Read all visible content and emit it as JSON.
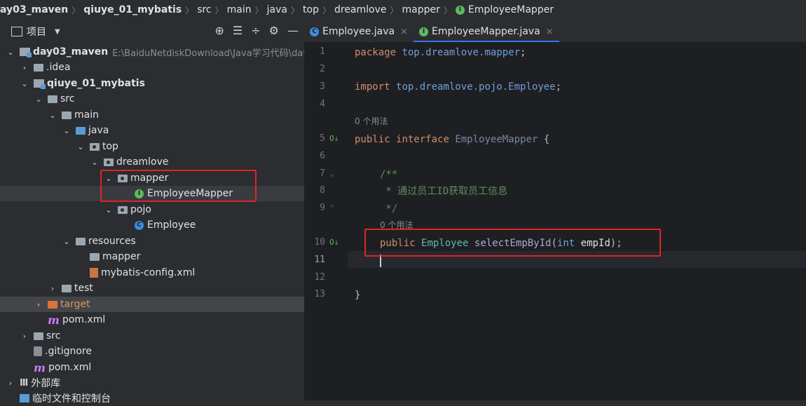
{
  "breadcrumb": [
    "ay03_maven",
    "qiuye_01_mybatis",
    "src",
    "main",
    "java",
    "top",
    "dreamlove",
    "mapper",
    "EmployeeMapper"
  ],
  "panel": {
    "title": "项目",
    "tools": [
      "⊕",
      "☰",
      "÷",
      "⚙",
      "—"
    ]
  },
  "tree": {
    "root_name": "day03_maven",
    "root_path": "E:\\BaiduNetdiskDownload\\Java学习代码\\day",
    "idea": ".idea",
    "module": "qiuye_01_mybatis",
    "src": "src",
    "main": "main",
    "java": "java",
    "top": "top",
    "dreamlove": "dreamlove",
    "mapper": "mapper",
    "employee_mapper": "EmployeeMapper",
    "pojo": "pojo",
    "employee": "Employee",
    "resources": "resources",
    "res_mapper": "mapper",
    "mybatis_config": "mybatis-config.xml",
    "test": "test",
    "target": "target",
    "pom_module": "pom.xml",
    "src_root": "src",
    "gitignore": ".gitignore",
    "pom_root": "pom.xml",
    "ext_libs": "外部库",
    "scratches": "临时文件和控制台"
  },
  "tabs": [
    {
      "label": "Employee.java",
      "close": "×"
    },
    {
      "label": "EmployeeMapper.java",
      "close": "×"
    }
  ],
  "editor": {
    "line_numbers": [
      "1",
      "2",
      "3",
      "4",
      "5",
      "6",
      "7",
      "8",
      "9",
      "10",
      "11",
      "12",
      "13"
    ],
    "current_line": "11",
    "usage_hint_1": "0 个用法",
    "usage_hint_2": "0 个用法",
    "l1_kw": "package",
    "l1_pkg": "top.dreamlove.mapper",
    "l1_end": ";",
    "l3_kw": "import",
    "l3_pkg": "top.dreamlove.pojo.",
    "l3_cls": "Employee",
    "l3_end": ";",
    "l5_kw1": "public",
    "l5_kw2": "interface",
    "l5_name": "EmployeeMapper",
    "l5_brace": "{",
    "l7": "/**",
    "l8": " * 通过员工ID获取员工信息",
    "l9": " */",
    "l10_kw": "public",
    "l10_type": "Employee",
    "l10_method": "selectEmpById",
    "l10_open": "(",
    "l10_ptype": "int",
    "l10_pname": "empId",
    "l10_close": ");",
    "l12": "}"
  },
  "colors": {
    "annotation_box": "#e02424",
    "active_tab_underline": "#3574f0",
    "interface_icon": "#5fb85f",
    "class_icon": "#3d8ee0"
  }
}
